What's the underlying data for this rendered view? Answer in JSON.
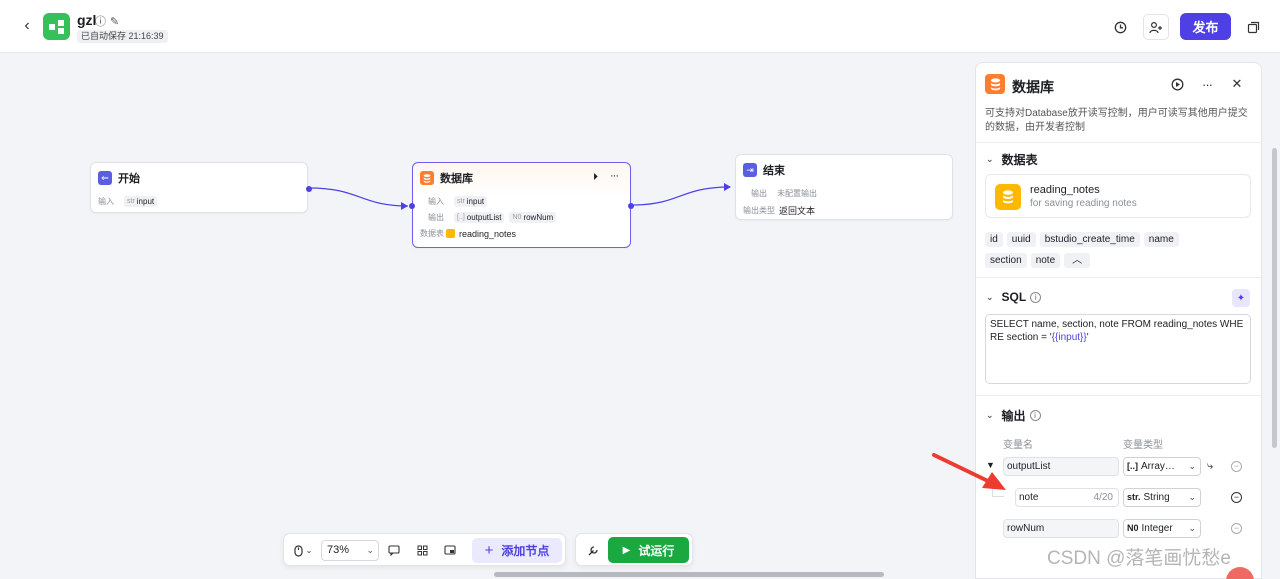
{
  "header": {
    "back_icon": "chevron-left-icon",
    "app_name": "gzl",
    "autosave": "已自动保存 21:16:39",
    "publish_label": "发布",
    "brand_color": "#4e40e5"
  },
  "canvas": {
    "start_node": {
      "title": "开始",
      "input_label": "输入",
      "input_type": "str",
      "input_name": "input"
    },
    "db_node": {
      "title": "数据库",
      "input_label": "输入",
      "input_type": "str",
      "input_name": "input",
      "output_label": "输出",
      "output1_type": "[..]",
      "output1_name": "outputList",
      "output2_type": "N0",
      "output2_name": "rowNum",
      "table_label": "数据表",
      "table_name": "reading_notes"
    },
    "end_node": {
      "title": "结束",
      "output_label": "输出",
      "output_value": "未配置输出",
      "type_label": "输出类型",
      "type_value": "返回文本"
    }
  },
  "toolbar": {
    "zoom": "73%",
    "add_node_label": "添加节点",
    "run_label": "试运行"
  },
  "panel": {
    "title": "数据库",
    "description": "可支持对Database放开读写控制，用户可读写其他用户提交的数据，由开发者控制",
    "table_section": "数据表",
    "table_name": "reading_notes",
    "table_desc": "for saving reading notes",
    "fields": [
      "id",
      "uuid",
      "bstudio_create_time",
      "name",
      "section",
      "note"
    ],
    "sql_section": "SQL",
    "sql_text": "SELECT name, section, note FROM reading_notes WHERE section = '",
    "sql_var": "{{input}}",
    "sql_end": "'",
    "output_section": "输出",
    "col_var_name": "变量名",
    "col_var_type": "变量类型",
    "outputs": [
      {
        "name": "outputList",
        "type_prefix": "[..]",
        "type": "Array…"
      },
      {
        "name": "note",
        "count": "4/20",
        "type_prefix": "str.",
        "type": "String"
      },
      {
        "name": "rowNum",
        "type_prefix": "N0",
        "type": "Integer"
      }
    ]
  },
  "watermark": "CSDN @落笔画忧愁e"
}
